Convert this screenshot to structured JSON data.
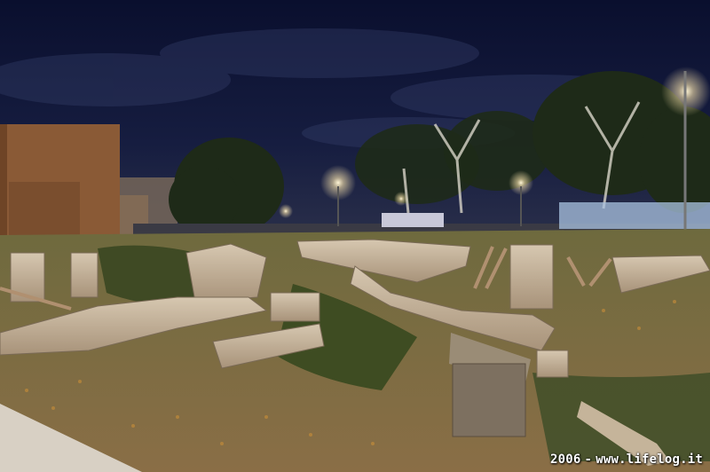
{
  "photo": {
    "year": "2006",
    "separator": "-",
    "site": "www.lifelog.it"
  },
  "colors": {
    "sky_top": "#0a0f2e",
    "sky_bottom": "#1c2448",
    "lamp_glow": "#ffe9b0",
    "stone": "#c9b8a2",
    "grass": "#4a5a2a",
    "ground": "#8a6e46"
  }
}
